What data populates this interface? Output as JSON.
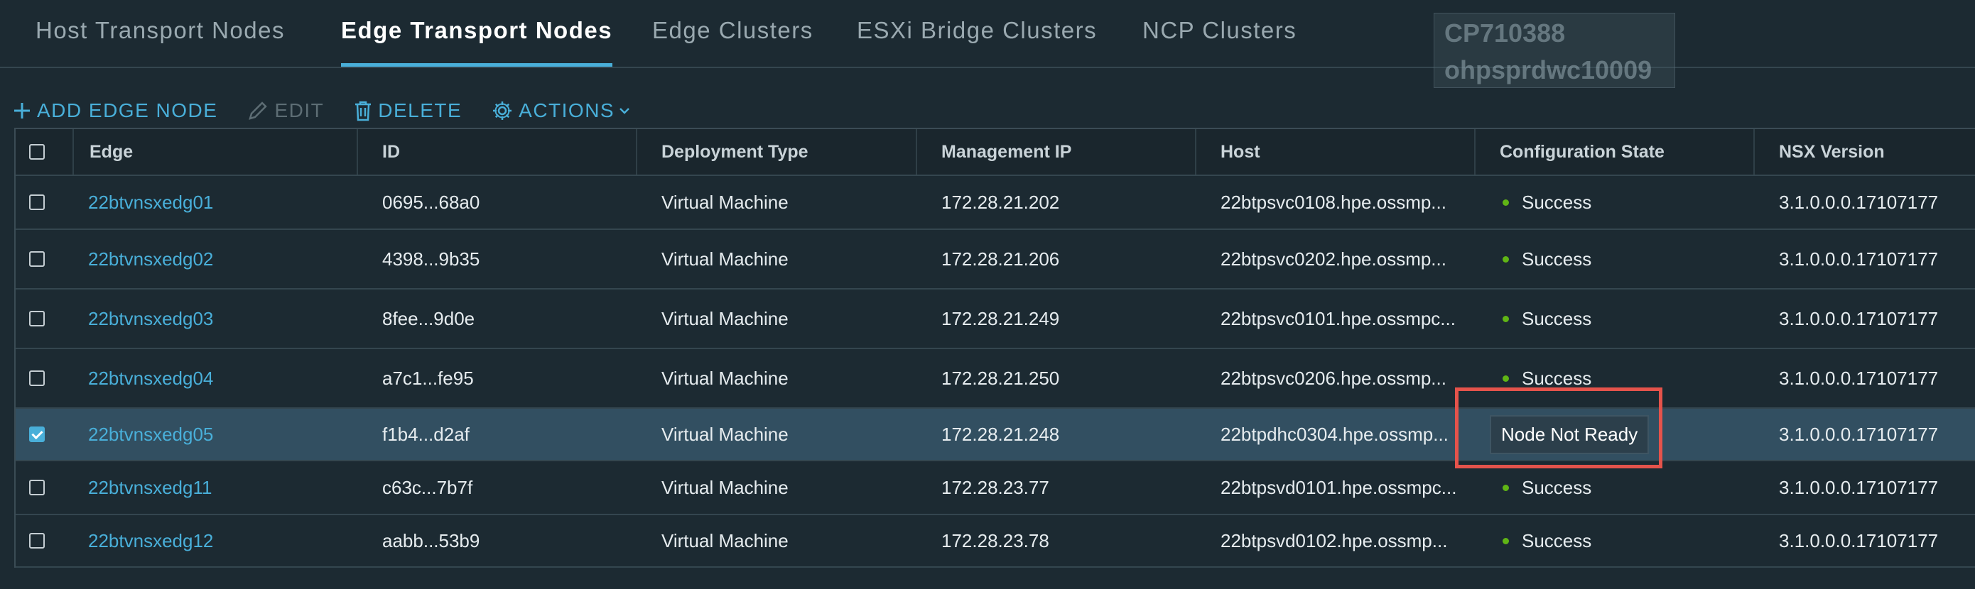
{
  "tabs": [
    {
      "label": "Host Transport Nodes"
    },
    {
      "label": "Edge Transport Nodes"
    },
    {
      "label": "Edge Clusters"
    },
    {
      "label": "ESXi Bridge Clusters"
    },
    {
      "label": "NCP Clusters"
    }
  ],
  "overlay": {
    "line1": "CP710388",
    "line2": "ohpsprdwc10009"
  },
  "toolbar": {
    "add_label": "ADD EDGE NODE",
    "edit_label": "EDIT",
    "delete_label": "DELETE",
    "actions_label": "ACTIONS"
  },
  "table": {
    "columns": [
      "Edge",
      "ID",
      "Deployment Type",
      "Management IP",
      "Host",
      "Configuration State",
      "NSX Version"
    ],
    "rows": [
      {
        "edge": "22btvnsxedg01",
        "id": "0695...68a0",
        "deployment": "Virtual Machine",
        "ip": "172.28.21.202",
        "host": "22btpsvc0108.hpe.ossmp...",
        "state": "Success",
        "version": "3.1.0.0.0.17107177"
      },
      {
        "edge": "22btvnsxedg02",
        "id": "4398...9b35",
        "deployment": "Virtual Machine",
        "ip": "172.28.21.206",
        "host": "22btpsvc0202.hpe.ossmp...",
        "state": "Success",
        "version": "3.1.0.0.0.17107177"
      },
      {
        "edge": "22btvnsxedg03",
        "id": "8fee...9d0e",
        "deployment": "Virtual Machine",
        "ip": "172.28.21.249",
        "host": "22btpsvc0101.hpe.ossmpc...",
        "state": "Success",
        "version": "3.1.0.0.0.17107177"
      },
      {
        "edge": "22btvnsxedg04",
        "id": "a7c1...fe95",
        "deployment": "Virtual Machine",
        "ip": "172.28.21.250",
        "host": "22btpsvc0206.hpe.ossmp...",
        "state": "Success",
        "version": "3.1.0.0.0.17107177"
      },
      {
        "edge": "22btvnsxedg05",
        "id": "f1b4...d2af",
        "deployment": "Virtual Machine",
        "ip": "172.28.21.248",
        "host": "22btpdhc0304.hpe.ossmp...",
        "state": "Node Not Ready",
        "version": "3.1.0.0.0.17107177"
      },
      {
        "edge": "22btvnsxedg11",
        "id": "c63c...7b7f",
        "deployment": "Virtual Machine",
        "ip": "172.28.23.77",
        "host": "22btpsvd0101.hpe.ossmpc...",
        "state": "Success",
        "version": "3.1.0.0.0.17107177"
      },
      {
        "edge": "22btvnsxedg12",
        "id": "aabb...53b9",
        "deployment": "Virtual Machine",
        "ip": "172.28.23.78",
        "host": "22btpsvd0102.hpe.ossmp...",
        "state": "Success",
        "version": "3.1.0.0.0.17107177"
      }
    ],
    "selected_row_index": 4
  },
  "colors": {
    "accent": "#49afd9",
    "success_dot": "#60b515",
    "highlight_box": "#e5534b",
    "selected_row": "#324f61"
  },
  "icons": {
    "add": "plus-icon",
    "edit": "pencil-icon",
    "delete": "trash-icon",
    "actions": "gear-icon",
    "actions_caret": "chevron-down-icon"
  }
}
